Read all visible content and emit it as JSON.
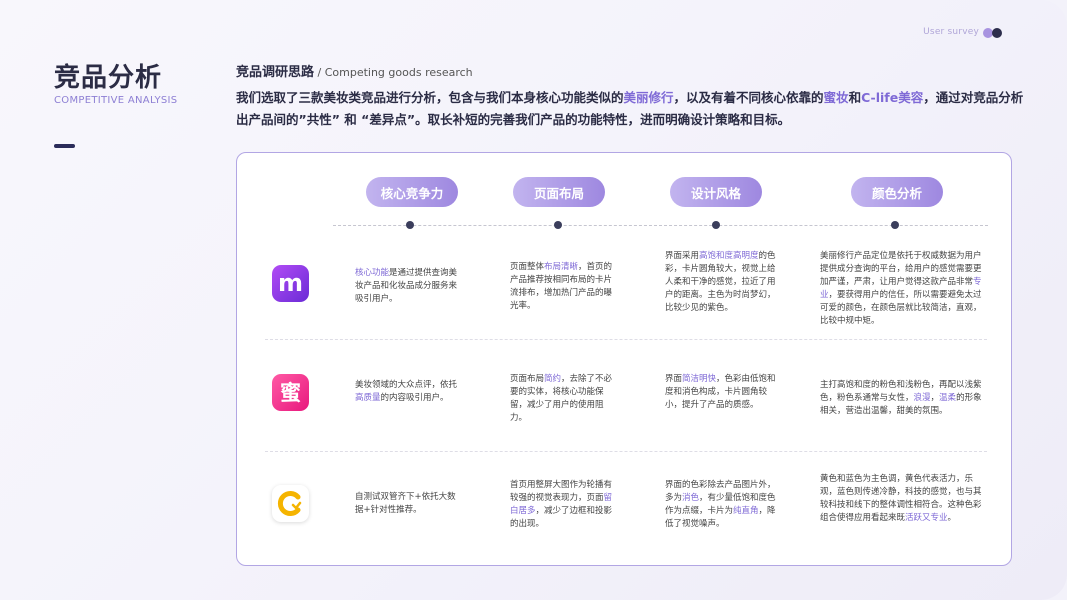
{
  "top_right": {
    "label": "User survey"
  },
  "title": {
    "main": "竞品分析",
    "sub": "COMPETITIVE ANALYSIS"
  },
  "section": {
    "title_zh": "竞品调研思路",
    "title_en": " / Competing goods research"
  },
  "intro": [
    {
      "text": "我们选取了三款美妆类竞品进行分析，包含与我们本身核心功能类似的",
      "hl": false
    },
    {
      "text": "美丽修行",
      "hl": true
    },
    {
      "text": "，以及有着不同核心依靠的",
      "hl": false
    },
    {
      "text": "蜜妆",
      "hl": true
    },
    {
      "text": "和",
      "hl": false
    },
    {
      "text": "C-life美容",
      "hl": true
    },
    {
      "text": "，通过对竞品分析出产品间的”共性” 和 “差异点”。取长补短的完善我们产品的功能特性，进而明确设计策略和目标。",
      "hl": false
    }
  ],
  "columns": [
    "核心竞争力",
    "页面布局",
    "设计风格",
    "颜色分析"
  ],
  "apps": [
    {
      "icon": "meili-xiuxing-app-icon",
      "glyph": "m",
      "color": "#8b3ae8"
    },
    {
      "icon": "mizhuang-app-icon",
      "glyph": "蜜",
      "color": "#f0358e"
    },
    {
      "icon": "clife-beauty-app-icon",
      "glyph": "C",
      "color": "#f5b400"
    }
  ],
  "rows": [
    {
      "core": [
        {
          "text": "核心功能",
          "hl": true
        },
        {
          "text": "是通过提供查询美妆产品和化妆品成分服务来吸引用户。",
          "hl": false
        }
      ],
      "layout": [
        {
          "text": "页面整体",
          "hl": false
        },
        {
          "text": "布局清晰",
          "hl": true
        },
        {
          "text": "，首页的产品推荐按相同布局的卡片流排布，增加热门产品的曝光率。",
          "hl": false
        }
      ],
      "style": [
        {
          "text": "界面采用",
          "hl": false
        },
        {
          "text": "高饱和度高明度",
          "hl": true
        },
        {
          "text": "的色彩，卡片圆角较大，视觉上给人柔和干净的感觉，拉近了用户的距离。主色为时尚梦幻，比较少见的紫色。",
          "hl": false
        }
      ],
      "color": [
        {
          "text": "美丽修行产品定位是依托于权威数据为用户提供成分查询的平台，给用户的感觉需要更加严谨，严肃，让用户觉得这款产品非常",
          "hl": false
        },
        {
          "text": "专业",
          "hl": true
        },
        {
          "text": "，要获得用户的信任，所以需要避免太过可爱的颜色，在颜色层就比较简洁，直观，比较中规中矩。",
          "hl": false
        }
      ]
    },
    {
      "core": [
        {
          "text": "美妆领域的大众点评，依托",
          "hl": false
        },
        {
          "text": "高质量",
          "hl": true
        },
        {
          "text": "的内容吸引用户。",
          "hl": false
        }
      ],
      "layout": [
        {
          "text": "页面布局",
          "hl": false
        },
        {
          "text": "简约",
          "hl": true
        },
        {
          "text": "，去除了不必要的实体，将核心功能保留，减少了用户的使用阻力。",
          "hl": false
        }
      ],
      "style": [
        {
          "text": "界面",
          "hl": false
        },
        {
          "text": "简洁明快",
          "hl": true
        },
        {
          "text": "，色彩由低饱和度和消色构成，卡片圆角较小，提升了产品的质感。",
          "hl": false
        }
      ],
      "color": [
        {
          "text": "主打高饱和度的粉色和浅粉色，再配以浅紫色，粉色系通常与女性，",
          "hl": false
        },
        {
          "text": "浪漫",
          "hl": true
        },
        {
          "text": "，",
          "hl": false
        },
        {
          "text": "温柔",
          "hl": true
        },
        {
          "text": "的形象相关，营造出温馨，甜美的氛围。",
          "hl": false
        }
      ]
    },
    {
      "core": [
        {
          "text": "自测试双管齐下+依托大数据+针对性推荐。",
          "hl": false
        }
      ],
      "layout": [
        {
          "text": "首页用整屏大图作为轮播有较强的视觉表现力，页面",
          "hl": false
        },
        {
          "text": "留白居多",
          "hl": true
        },
        {
          "text": "，减少了边框和投影的出现。",
          "hl": false
        }
      ],
      "style": [
        {
          "text": "界面的色彩除去产品图片外，多为",
          "hl": false
        },
        {
          "text": "消色",
          "hl": true
        },
        {
          "text": "，有少量低饱和度色作为点缀，卡片为",
          "hl": false
        },
        {
          "text": "纯直角",
          "hl": true
        },
        {
          "text": "，降低了视觉噪声。",
          "hl": false
        }
      ],
      "color": [
        {
          "text": "黄色和蓝色为主色调，黄色代表活力，乐观，蓝色则传递冷静，科技的感觉，也与其较科技和线下的整体调性相符合。这种色彩组合使得应用看起来既",
          "hl": false
        },
        {
          "text": "活跃又专业",
          "hl": true
        },
        {
          "text": "。",
          "hl": false
        }
      ]
    }
  ]
}
